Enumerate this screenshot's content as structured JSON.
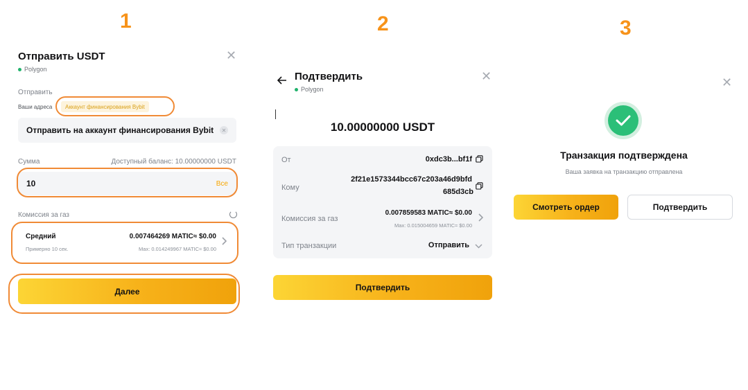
{
  "steps": {
    "s1": "1",
    "s2": "2",
    "s3": "3"
  },
  "panel1": {
    "title": "Отправить USDT",
    "network": "Polygon",
    "send_label": "Отправить",
    "your_addresses": "Ваши адреса",
    "funding_chip": "Аккаунт финансирования Bybit",
    "recipient": "Отправить на аккаунт финансирования Bybit",
    "amount_label": "Сумма",
    "available_balance": "Доступный баланс: 10.00000000 USDT",
    "amount_value": "10",
    "all_button": "Все",
    "gas_label": "Комиссия за газ",
    "gas_speed": "Средний",
    "gas_time": "Примерно 10 сек.",
    "gas_fee": "0.007464269 MATIC≈ $0.00",
    "gas_max": "Max: 0.014249967 MATIC≈ $0.00",
    "next_button": "Далее"
  },
  "panel2": {
    "title": "Подтвердить",
    "network": "Polygon",
    "amount": "10.00000000 USDT",
    "from_label": "От",
    "from_value": "0xdc3b...bf1f",
    "to_label": "Кому",
    "to_line1": "2f21e1573344bcc67c203a46d9bfd",
    "to_line2": "685d3cb",
    "gas_label": "Комиссия за газ",
    "gas_fee": "0.007859583 MATIC≈ $0.00",
    "gas_max": "Max: 0.015004659 MATIC≈ $0.00",
    "type_label": "Тип транзакции",
    "type_value": "Отправить",
    "confirm_button": "Подтвердить"
  },
  "panel3": {
    "title": "Транзакция подтверждена",
    "subtitle": "Ваша заявка на транзакцию отправлена",
    "view_order_button": "Смотреть ордер",
    "confirm_button": "Подтвердить"
  },
  "colors": {
    "accent": "#f08a35",
    "step_number": "#f7931a",
    "button_gold": "#fcd535",
    "success_green": "#20b26c",
    "chip_bg": "#fdf3dc",
    "chip_text": "#d9a018"
  }
}
